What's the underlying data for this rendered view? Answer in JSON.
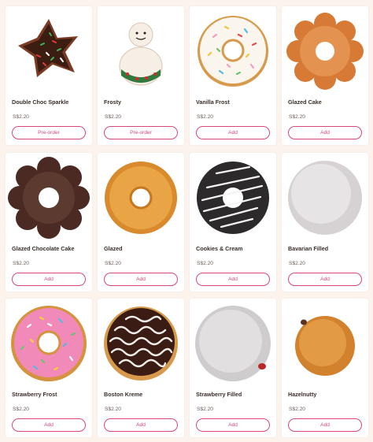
{
  "colors": {
    "accent": "#d9467e",
    "page_bg": "#fbf3ec",
    "card_bg": "#ffffff"
  },
  "products": [
    {
      "name": "Double Choc Sparkle",
      "price": "S$2.20",
      "button": "Pre-order",
      "image": "star-chocolate-sprinkle-donut"
    },
    {
      "name": "Frosty",
      "price": "S$2.20",
      "button": "Pre-order",
      "image": "snowman-donut"
    },
    {
      "name": "Vanilla Frost",
      "price": "S$2.20",
      "button": "Add",
      "image": "vanilla-sprinkle-donut"
    },
    {
      "name": "Glazed Cake",
      "price": "S$2.20",
      "button": "Add",
      "image": "french-cruller-donut"
    },
    {
      "name": "Glazed Chocolate Cake",
      "price": "S$2.20",
      "button": "Add",
      "image": "chocolate-cruller-donut"
    },
    {
      "name": "Glazed",
      "price": "S$2.20",
      "button": "Add",
      "image": "glazed-donut"
    },
    {
      "name": "Cookies & Cream",
      "price": "S$2.20",
      "button": "Add",
      "image": "cookies-cream-donut"
    },
    {
      "name": "Bavarian Filled",
      "price": "S$2.20",
      "button": "Add",
      "image": "powdered-filled-donut"
    },
    {
      "name": "Strawberry Frost",
      "price": "S$2.20",
      "button": "Add",
      "image": "strawberry-sprinkle-donut"
    },
    {
      "name": "Boston Kreme",
      "price": "S$2.20",
      "button": "Add",
      "image": "boston-kreme-donut"
    },
    {
      "name": "Strawberry Filled",
      "price": "S$2.20",
      "button": "Add",
      "image": "sugar-filled-donut"
    },
    {
      "name": "Hazelnutty",
      "price": "S$2.20",
      "button": "Add",
      "image": "hazelnut-ball-donut"
    }
  ]
}
